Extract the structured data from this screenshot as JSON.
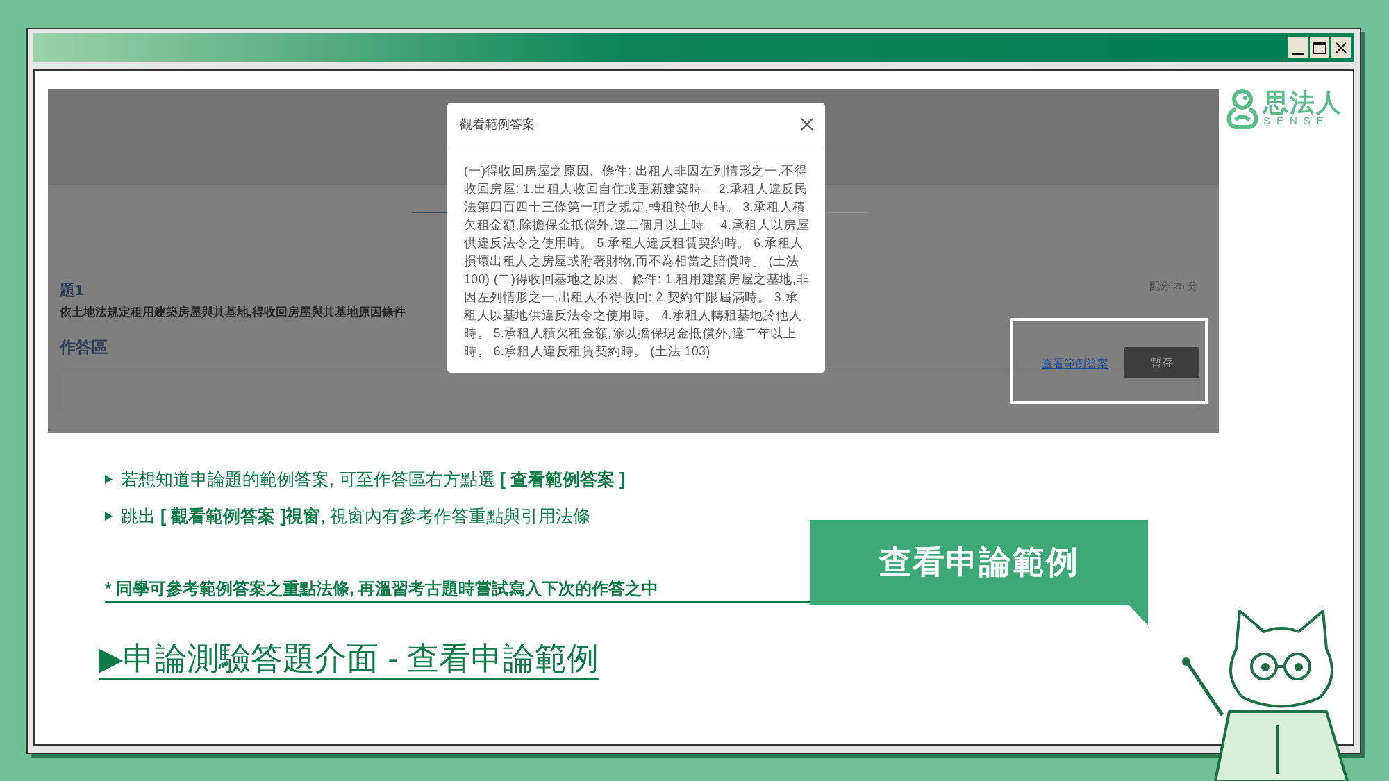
{
  "logo": {
    "name": "思法人",
    "tagline": "SENSE"
  },
  "screenshot": {
    "dialog": {
      "title": "觀看範例答案",
      "body": "(一)得收回房屋之原因、條件: 出租人非因左列情形之一,不得收回房屋: 1.出租人收回自住或重新建築時。 2.承租人違反民法第四百四十三條第一項之規定,轉租於他人時。 3.承租人積欠租金額,除擔保金抵償外,達二個月以上時。 4.承租人以房屋供違反法令之使用時。 5.承租人違反租賃契約時。 6.承租人損壞出租人之房屋或附著財物,而不為相當之賠償時。 (土法 100) (二)得收回基地之原因、條件: 1.租用建築房屋之基地,非因左列情形之一,出租人不得收回: 2.契約年限屆滿時。 3.承租人以基地供違反法令之使用時。 4.承租人轉租基地於他人時。 5.承租人積欠租金額,除以擔保現金抵償外,達二年以上時。 6.承租人違反租賃契約時。 (土法 103)"
    },
    "question": {
      "label": "題1",
      "text": "依土地法規定租用建築房屋與其基地,得收回房屋與其基地原因條件",
      "score": "配分 25 分"
    },
    "answer_area": {
      "title": "作答區",
      "link": "查看範例答案",
      "save_button": "暫存"
    }
  },
  "notes": [
    {
      "text": "若想知道申論題的範例答案, 可至作答區右方點選 **[ 查看範例答案 ]**"
    },
    {
      "text": "跳出 **[ 觀看範例答案 ]視窗**, 視窗內有參考作答重點與引用法條"
    }
  ],
  "tip": "* 同學可參考範例答案之重點法條, 再溫習考古題時嘗試寫入下次的作答之中",
  "heading": "▶申論測驗答題介面 - 查看申論範例",
  "banner": "查看申論範例"
}
